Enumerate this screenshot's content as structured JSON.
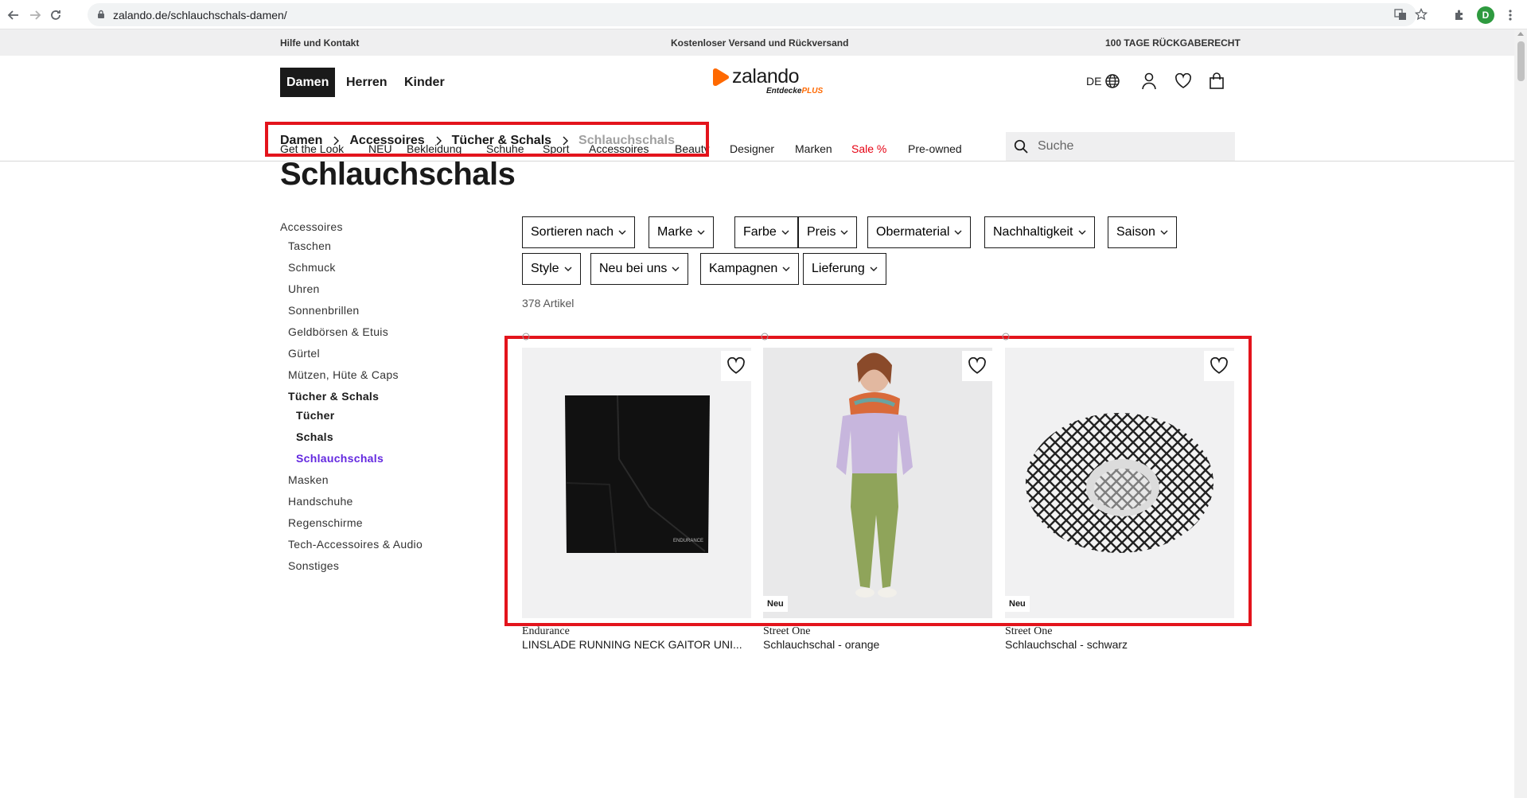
{
  "browser": {
    "url": "zalando.de/schlauchschals-damen/",
    "profile_initial": "D"
  },
  "topbar": {
    "help": "Hilfe und Kontakt",
    "shipping": "Kostenloser Versand und Rückversand",
    "returns": "100 TAGE RÜCKGABERECHT"
  },
  "header": {
    "genders": [
      "Damen",
      "Herren",
      "Kinder"
    ],
    "logo_text": "zalando",
    "logo_tagline": "Entdecke",
    "logo_plus": "PLUS",
    "language": "DE",
    "categories": [
      "Get the Look",
      "NEU",
      "Bekleidung",
      "Schuhe",
      "Sport",
      "Accessoires",
      "Beauty",
      "Designer",
      "Marken",
      "Sale %",
      "Pre-owned"
    ],
    "search_placeholder": "Suche"
  },
  "breadcrumb": {
    "items": [
      "Damen",
      "Accessoires",
      "Tücher & Schals"
    ],
    "current": "Schlauchschals"
  },
  "page_title": "Schlauchschals",
  "sidebar": {
    "root": "Accessoires",
    "items": [
      {
        "label": "Taschen",
        "level": 1
      },
      {
        "label": "Schmuck",
        "level": 1
      },
      {
        "label": "Uhren",
        "level": 1
      },
      {
        "label": "Sonnenbrillen",
        "level": 1
      },
      {
        "label": "Geldbörsen & Etuis",
        "level": 1
      },
      {
        "label": "Gürtel",
        "level": 1
      },
      {
        "label": "Mützen, Hüte & Caps",
        "level": 1
      },
      {
        "label": "Tücher & Schals",
        "level": 1,
        "bold": true
      },
      {
        "label": "Tücher",
        "level": 2,
        "bold": true
      },
      {
        "label": "Schals",
        "level": 2,
        "bold": true
      },
      {
        "label": "Schlauchschals",
        "level": 2,
        "selected": true
      },
      {
        "label": "Masken",
        "level": 1
      },
      {
        "label": "Handschuhe",
        "level": 1
      },
      {
        "label": "Regenschirme",
        "level": 1
      },
      {
        "label": "Tech-Accessoires & Audio",
        "level": 1
      },
      {
        "label": "Sonstiges",
        "level": 1
      }
    ]
  },
  "filters": {
    "row1": [
      "Sortieren nach",
      "Marke",
      "Farbe",
      "Preis",
      "Obermaterial",
      "Nachhaltigkeit",
      "Saison"
    ],
    "row2": [
      "Style",
      "Neu bei uns",
      "Kampagnen",
      "Lieferung"
    ]
  },
  "result_count": "378 Artikel",
  "products": [
    {
      "brand": "Endurance",
      "name": "LINSLADE RUNNING NECK GAITOR UNI...",
      "badge": "",
      "image_text": "ENDURANCE"
    },
    {
      "brand": "Street One",
      "name": "Schlauchschal - orange",
      "badge": "Neu"
    },
    {
      "brand": "Street One",
      "name": "Schlauchschal - schwarz",
      "badge": "Neu"
    }
  ],
  "colors": {
    "accent_red": "#e3141c",
    "selected_purple": "#6328e0",
    "sale_red": "#e60012",
    "brand_orange": "#ff6900"
  }
}
